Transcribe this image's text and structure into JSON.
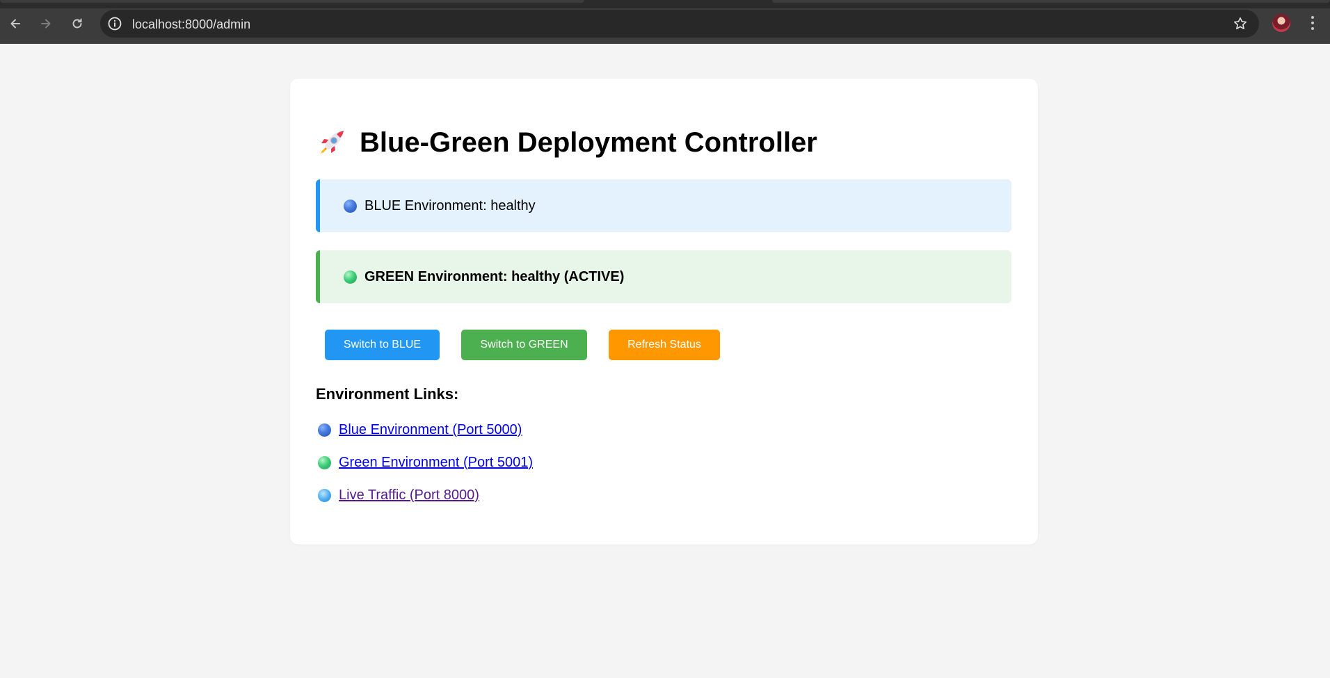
{
  "browser": {
    "url": "localhost:8000/admin"
  },
  "page": {
    "title": "Blue-Green Deployment Controller",
    "title_icon": "rocket-icon",
    "environments": [
      {
        "icon": "blue-circle-icon",
        "label": "BLUE Environment: healthy",
        "accent": "#2196f3",
        "background": "#e3f2fd"
      },
      {
        "icon": "green-circle-icon",
        "label": "GREEN Environment: healthy (ACTIVE)",
        "accent": "#4caf50",
        "background": "#e8f5e9"
      }
    ],
    "buttons": {
      "switch_blue": "Switch to BLUE",
      "switch_green": "Switch to GREEN",
      "refresh": "Refresh Status"
    },
    "button_colors": {
      "switch_blue": "#2196f3",
      "switch_green": "#4caf50",
      "refresh": "#ff9800"
    },
    "links_heading": "Environment Links:",
    "links": [
      {
        "icon": "blue-circle-icon",
        "label": "Blue Environment (Port 5000)"
      },
      {
        "icon": "green-circle-icon",
        "label": "Green Environment (Port 5001)"
      },
      {
        "icon": "globe-icon",
        "label": "Live Traffic (Port 8000)"
      }
    ]
  }
}
